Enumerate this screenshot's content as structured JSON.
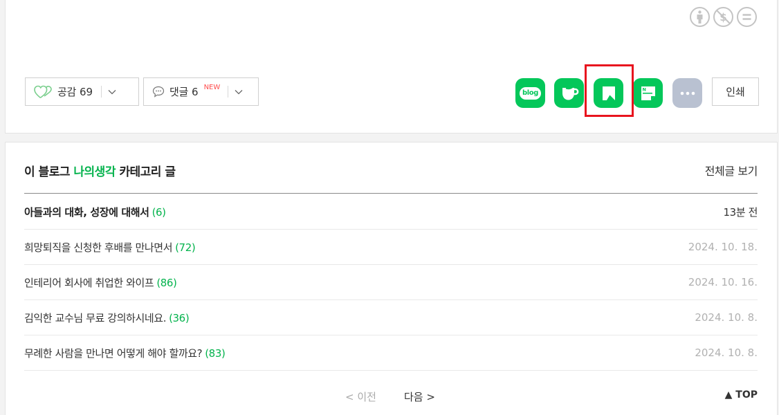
{
  "reactions": {
    "like_label": "공감",
    "like_count": "69",
    "comment_label": "댓글",
    "comment_count": "6",
    "new_badge": "NEW"
  },
  "share": {
    "blog_text": "blog",
    "print_label": "인쇄",
    "services": [
      "blog",
      "cafe",
      "keep",
      "memo",
      "more"
    ]
  },
  "category": {
    "prefix": "이 블로그 ",
    "name": "나의생각",
    "suffix": " 카테고리 글",
    "view_all": "전체글 보기"
  },
  "posts": [
    {
      "title": "아들과의 대화, 성장에 대해서",
      "comments": "(6)",
      "date": "13분 전"
    },
    {
      "title": "희망퇴직을 신청한 후배를 만나면서",
      "comments": "(72)",
      "date": "2024. 10. 18."
    },
    {
      "title": "인테리어 회사에 취업한 와이프",
      "comments": "(86)",
      "date": "2024. 10. 16."
    },
    {
      "title": "김익한 교수님 무료 강의하시네요.",
      "comments": "(36)",
      "date": "2024. 10. 8."
    },
    {
      "title": "무례한 사람을 만나면 어떻게 해야 할까요?",
      "comments": "(83)",
      "date": "2024. 10. 8."
    }
  ],
  "pagination": {
    "prev": "< 이전",
    "next": "다음 >",
    "top": "▲ TOP"
  },
  "colors": {
    "naver_green": "#04c75a",
    "category_green": "#04b34d",
    "highlight_red": "#e8141e",
    "more_gray": "#b9c1d1"
  }
}
